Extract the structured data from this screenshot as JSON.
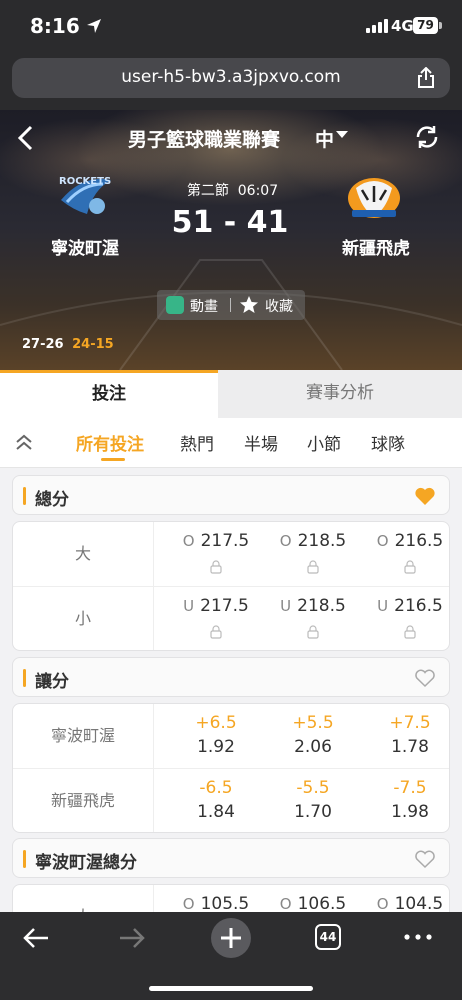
{
  "status_bar": {
    "time": "8:16",
    "network": "4G",
    "battery": "79"
  },
  "browser": {
    "url": "user-h5-bw3.a3jpxvo.com",
    "tab_count": "44"
  },
  "match": {
    "league": "男子籃球職業聯賽",
    "language": "中",
    "home_team": "寧波町渥",
    "away_team": "新疆飛虎",
    "period": "第二節",
    "clock": "06:07",
    "score": "51 - 41",
    "animation_label": "動畫",
    "favorite_label": "收藏",
    "quarter_scores": [
      "27-26",
      "24-15"
    ]
  },
  "tabs": {
    "bet": "投注",
    "analysis": "賽事分析"
  },
  "sub_nav": [
    "所有投注",
    "熱門",
    "半場",
    "小節",
    "球隊"
  ],
  "markets": {
    "total": {
      "title": "總分",
      "rows": [
        {
          "label": "大",
          "prefix": "O",
          "lines": [
            "217.5",
            "218.5",
            "216.5"
          ]
        },
        {
          "label": "小",
          "prefix": "U",
          "lines": [
            "217.5",
            "218.5",
            "216.5"
          ]
        }
      ]
    },
    "handicap": {
      "title": "讓分",
      "rows": [
        {
          "label": "寧波町渥",
          "lines": [
            "+6.5",
            "+5.5",
            "+7.5"
          ],
          "odds": [
            "1.92",
            "2.06",
            "1.78"
          ]
        },
        {
          "label": "新疆飛虎",
          "lines": [
            "-6.5",
            "-5.5",
            "-7.5"
          ],
          "odds": [
            "1.84",
            "1.70",
            "1.98"
          ]
        }
      ]
    },
    "home_total": {
      "title": "寧波町渥總分",
      "rows": [
        {
          "label": "大",
          "prefix": "O",
          "lines": [
            "105.5",
            "106.5",
            "104.5"
          ]
        }
      ]
    }
  },
  "colors": {
    "accent": "#f5a623",
    "header_bg": "#2b2b2d",
    "page_bg": "#f2f2f4"
  }
}
